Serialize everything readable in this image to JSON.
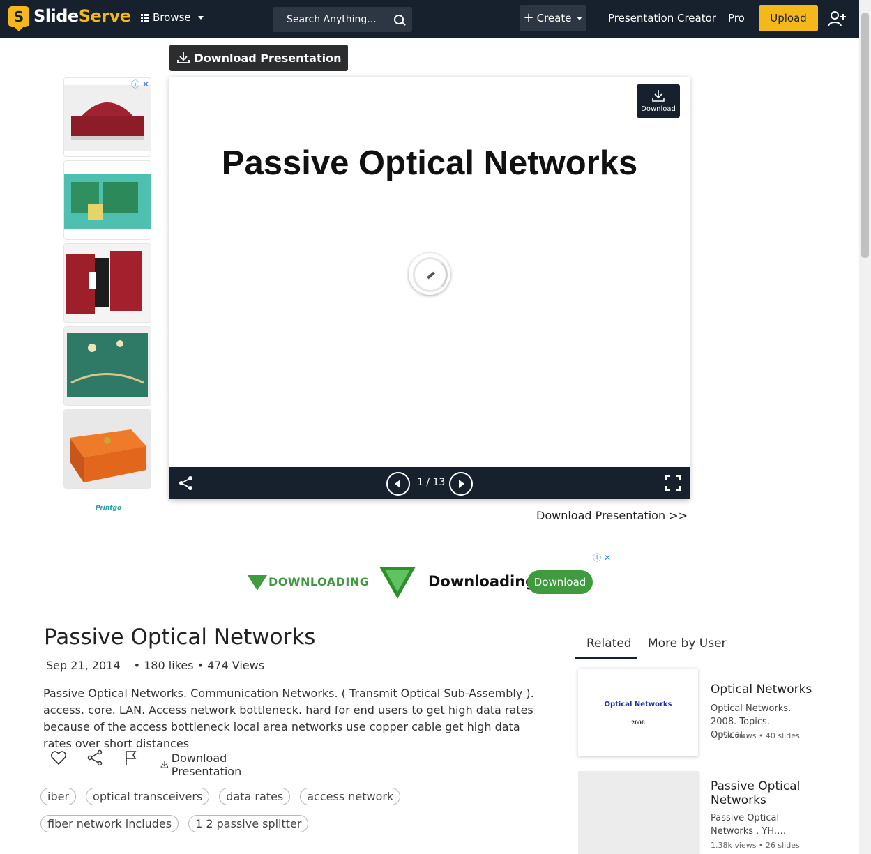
{
  "header": {
    "logo_letter": "S",
    "logo_part1": "Slide",
    "logo_part2": "Serve",
    "browse": "Browse",
    "search_placeholder": "Search Anything...",
    "create": "Create",
    "presentation_creator": "Presentation Creator",
    "pro": "Pro",
    "upload": "Upload"
  },
  "toolbar": {
    "download_presentation": "Download Presentation"
  },
  "ads": {
    "side_brand": "Printgo",
    "banner_text_small": "DOWNLOADING",
    "banner_text_big": "Downloading",
    "banner_button": "Download"
  },
  "viewer": {
    "slide_title": "Passive Optical Networks",
    "download_label": "Download",
    "page_indicator": "1 / 13"
  },
  "download_link": "Download Presentation >>",
  "presentation": {
    "title": "Passive Optical Networks",
    "date": "Sep 21, 2014",
    "stats": "• 180 likes • 474 Views",
    "description": "Passive Optical Networks. Communication Networks. ( Transmit Optical Sub-Assembly ). access. core. LAN. Access network bottleneck. hard for end users to get high data rates because of the access bottleneck local area networks use copper cable get high data rates over short distances",
    "download_action": "Download Presentation",
    "tags": [
      "iber",
      "optical transceivers",
      "data rates",
      "access network",
      "fiber network includes",
      "1 2 passive splitter"
    ]
  },
  "sidebar": {
    "tabs": [
      "Related",
      "More by User"
    ],
    "related": [
      {
        "thumb_title": "Optical Networks",
        "thumb_sub": "2008",
        "title": "Optical Networks",
        "description": "Optical Networks. 2008. Topics. Optical…",
        "stats": "1.05k views • 40 slides"
      },
      {
        "title": "Passive Optical Networks",
        "description": "Passive Optical Networks . YH.…",
        "stats": "1.38k views • 26 slides"
      }
    ]
  },
  "colors": {
    "brand_dark": "#16212d",
    "brand_yellow": "#f5b81c",
    "ad_green": "#3e9b3e"
  }
}
